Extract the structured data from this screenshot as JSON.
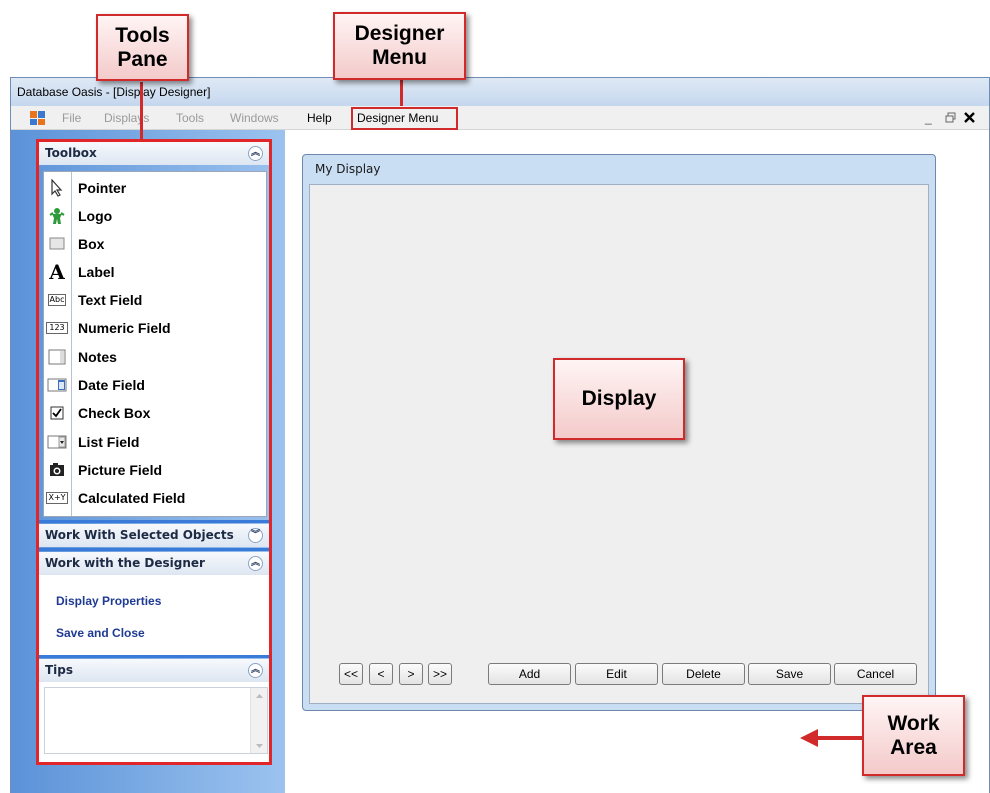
{
  "window": {
    "title": "Database Oasis - [Display Designer]"
  },
  "menubar": {
    "items": [
      {
        "label": "File"
      },
      {
        "label": "Displays"
      },
      {
        "label": "Tools"
      },
      {
        "label": "Windows"
      },
      {
        "label": "Help"
      },
      {
        "label": "Designer Menu"
      }
    ],
    "controls": {
      "minimize": "_",
      "restore": "🗗",
      "close": "✕"
    }
  },
  "toolbox": {
    "header": "Toolbox",
    "items": [
      {
        "label": "Pointer",
        "icon": "pointer-icon"
      },
      {
        "label": "Logo",
        "icon": "logo-icon"
      },
      {
        "label": "Box",
        "icon": "box-icon"
      },
      {
        "label": "Label",
        "icon": "label-icon"
      },
      {
        "label": "Text Field",
        "icon": "text-field-icon"
      },
      {
        "label": "Numeric Field",
        "icon": "numeric-field-icon"
      },
      {
        "label": "Notes",
        "icon": "notes-icon"
      },
      {
        "label": "Date Field",
        "icon": "date-field-icon"
      },
      {
        "label": "Check Box",
        "icon": "check-box-icon"
      },
      {
        "label": "List Field",
        "icon": "list-field-icon"
      },
      {
        "label": "Picture Field",
        "icon": "picture-field-icon"
      },
      {
        "label": "Calculated Field",
        "icon": "calculated-field-icon"
      }
    ],
    "icon_text": {
      "text_field": "Abc",
      "numeric_field": "123",
      "calculated_field": "X+Y",
      "label": "A"
    }
  },
  "sections": {
    "selected_objects": "Work With Selected Objects",
    "designer": "Work with the Designer",
    "designer_links": [
      "Display Properties",
      "Save and Close"
    ],
    "tips": "Tips"
  },
  "display": {
    "title": "My Display",
    "nav_buttons": [
      "<<",
      "<",
      ">",
      ">>"
    ],
    "action_buttons": [
      "Add",
      "Edit",
      "Delete",
      "Save",
      "Cancel"
    ]
  },
  "callouts": {
    "tools_pane": "Tools\nPane",
    "designer_menu": "Designer\nMenu",
    "display": "Display",
    "work_area": "Work\nArea"
  },
  "colors": {
    "callout_red": "#d12a2a",
    "pane_blue": "#5b92d8",
    "link_blue": "#1f3a93"
  }
}
